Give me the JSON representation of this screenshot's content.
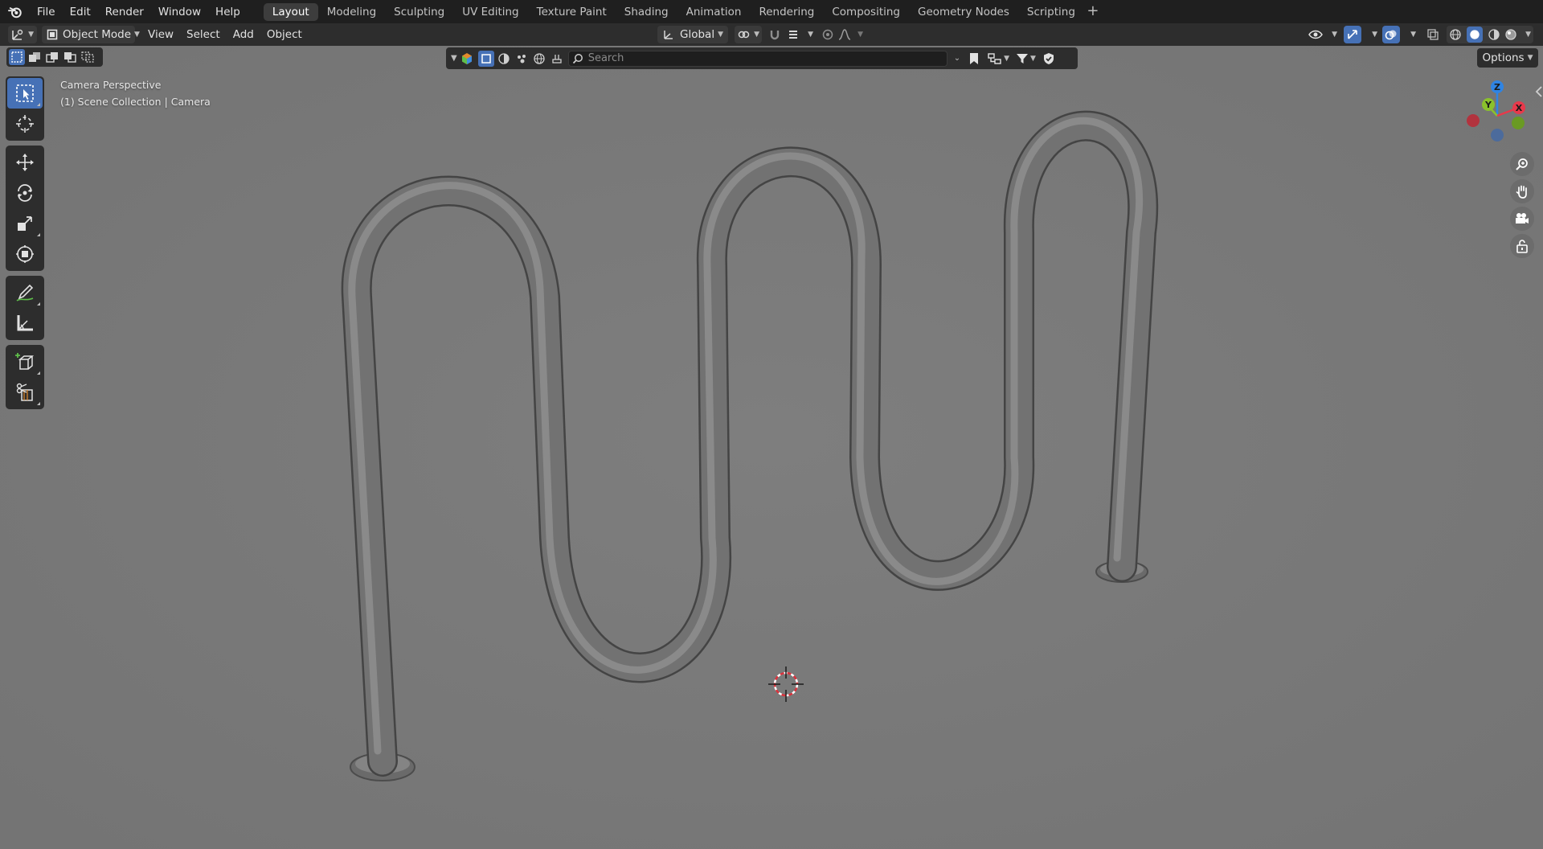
{
  "topbar": {
    "menus": [
      {
        "id": "file",
        "label": "File"
      },
      {
        "id": "edit",
        "label": "Edit"
      },
      {
        "id": "render",
        "label": "Render"
      },
      {
        "id": "window",
        "label": "Window"
      },
      {
        "id": "help",
        "label": "Help"
      }
    ],
    "workspaces": [
      {
        "label": "Layout",
        "active": true
      },
      {
        "label": "Modeling"
      },
      {
        "label": "Sculpting"
      },
      {
        "label": "UV Editing"
      },
      {
        "label": "Texture Paint"
      },
      {
        "label": "Shading"
      },
      {
        "label": "Animation"
      },
      {
        "label": "Rendering"
      },
      {
        "label": "Compositing"
      },
      {
        "label": "Geometry Nodes"
      },
      {
        "label": "Scripting"
      }
    ],
    "add_workspace_icon": "plus-icon"
  },
  "viewport_header": {
    "mode": "Object Mode",
    "menus": [
      "View",
      "Select",
      "Add",
      "Object"
    ],
    "transform_orientation": "Global",
    "options_label": "Options"
  },
  "outliner_bar": {
    "search_placeholder": "Search"
  },
  "overlay": {
    "view_name": "Camera Perspective",
    "collection_line": "(1) Scene Collection | Camera"
  },
  "gizmo": {
    "axes": [
      {
        "label": "Z",
        "color": "#2f84e3"
      },
      {
        "label": "Y",
        "color": "#8bc12c"
      },
      {
        "label": "X",
        "color": "#e8394b"
      }
    ]
  },
  "toolbar_tools": [
    "select-box-tool",
    "cursor-tool",
    "move-tool",
    "rotate-tool",
    "scale-tool",
    "transform-tool",
    "annotate-tool",
    "measure-tool",
    "add-cube-tool",
    "knife-tool"
  ],
  "colors": {
    "accent": "#4671b6",
    "viewport_bg": "#7a7a7a",
    "header_bg": "#2d2d2d",
    "topbar_bg": "#1f1f1f"
  }
}
